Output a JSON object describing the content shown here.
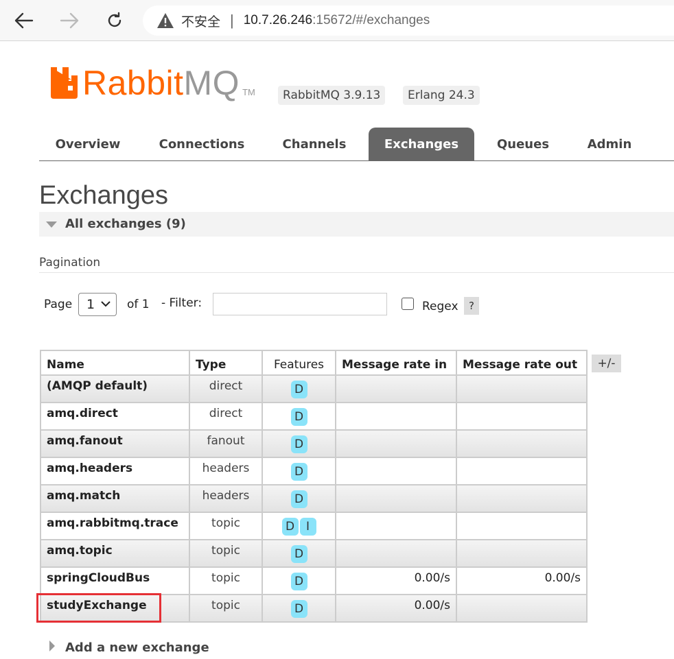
{
  "browser": {
    "insecure_label": "不安全",
    "url_host": "10.7.26.246",
    "url_rest": ":15672/#/exchanges"
  },
  "header": {
    "logo_rabbit": "Rabbit",
    "logo_mq": "MQ",
    "logo_tm": "TM",
    "rabbitmq_version": "RabbitMQ 3.9.13",
    "erlang_version": "Erlang 24.3"
  },
  "tabs": [
    {
      "label": "Overview"
    },
    {
      "label": "Connections"
    },
    {
      "label": "Channels"
    },
    {
      "label": "Exchanges"
    },
    {
      "label": "Queues"
    },
    {
      "label": "Admin"
    }
  ],
  "active_tab": "Exchanges",
  "page_title": "Exchanges",
  "section_label": "All exchanges (9)",
  "pagination": {
    "label": "Pagination",
    "page_label": "Page",
    "page_value": "1",
    "of_label": "of 1",
    "filter_label": "- Filter:",
    "filter_value": "",
    "regex_label": "Regex",
    "regex_checked": false,
    "help_label": "?"
  },
  "table": {
    "columns": [
      "Name",
      "Type",
      "Features",
      "Message rate in",
      "Message rate out"
    ],
    "toggle_columns_label": "+/-",
    "rows": [
      {
        "name": "(AMQP default)",
        "type": "direct",
        "features": [
          "D"
        ],
        "rate_in": "",
        "rate_out": ""
      },
      {
        "name": "amq.direct",
        "type": "direct",
        "features": [
          "D"
        ],
        "rate_in": "",
        "rate_out": ""
      },
      {
        "name": "amq.fanout",
        "type": "fanout",
        "features": [
          "D"
        ],
        "rate_in": "",
        "rate_out": ""
      },
      {
        "name": "amq.headers",
        "type": "headers",
        "features": [
          "D"
        ],
        "rate_in": "",
        "rate_out": ""
      },
      {
        "name": "amq.match",
        "type": "headers",
        "features": [
          "D"
        ],
        "rate_in": "",
        "rate_out": ""
      },
      {
        "name": "amq.rabbitmq.trace",
        "type": "topic",
        "features": [
          "D",
          "I"
        ],
        "rate_in": "",
        "rate_out": ""
      },
      {
        "name": "amq.topic",
        "type": "topic",
        "features": [
          "D"
        ],
        "rate_in": "",
        "rate_out": ""
      },
      {
        "name": "springCloudBus",
        "type": "topic",
        "features": [
          "D"
        ],
        "rate_in": "0.00/s",
        "rate_out": "0.00/s"
      },
      {
        "name": "studyExchange",
        "type": "topic",
        "features": [
          "D"
        ],
        "rate_in": "0.00/s",
        "rate_out": ""
      }
    ]
  },
  "add_new_label": "Add a new exchange",
  "colors": {
    "brand_orange": "#ff6600",
    "tab_active_bg": "#666666",
    "feature_badge": "#8ae3f9",
    "highlight_box": "#e53035"
  },
  "icons": [
    "back-arrow-icon",
    "forward-arrow-icon",
    "reload-icon",
    "warning-icon",
    "chevron-down-icon",
    "collapse-triangle-icon",
    "expand-triangle-icon"
  ]
}
